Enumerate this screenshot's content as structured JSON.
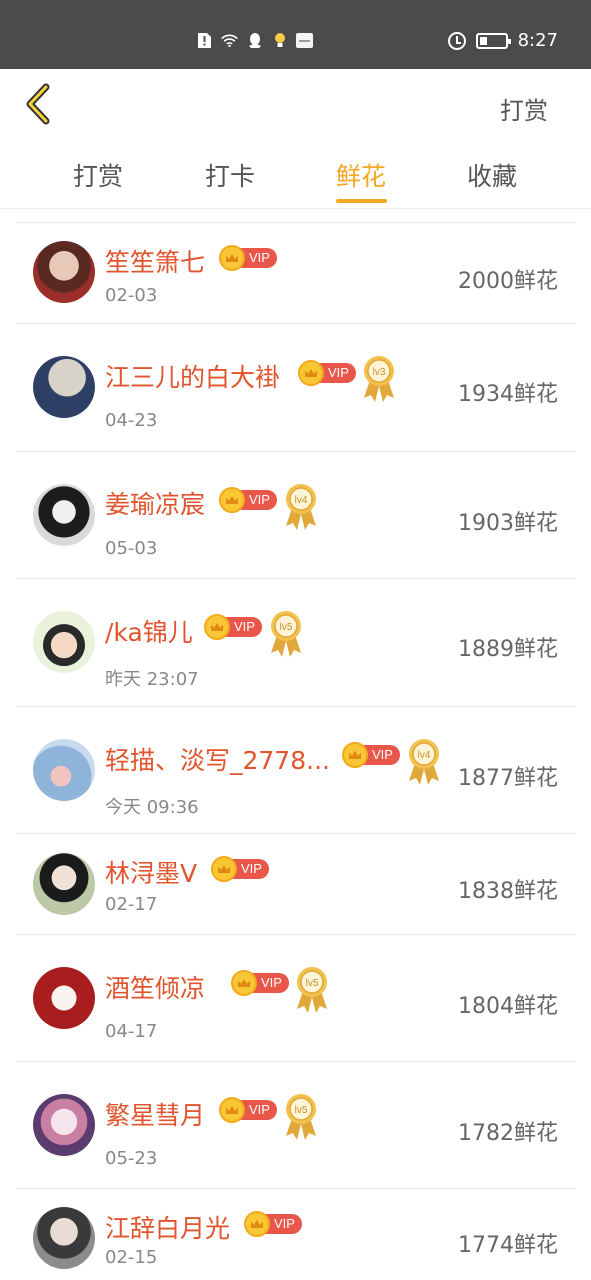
{
  "status_bar": {
    "icons": [
      "sim-alert-icon",
      "wifi-icon",
      "qq-icon",
      "bulb-icon",
      "app-notification-icon"
    ],
    "time": "8:27"
  },
  "header": {
    "back_icon": "chevron-left-icon",
    "action_label": "打赏"
  },
  "tabs": [
    {
      "label": "打赏",
      "active": false
    },
    {
      "label": "打卡",
      "active": false
    },
    {
      "label": "鲜花",
      "active": true
    },
    {
      "label": "收藏",
      "active": false
    }
  ],
  "vip_label": "VIP",
  "rows": [
    {
      "name": "笙笙箫七",
      "date": "02-03",
      "amount": "2000鲜花",
      "level": ""
    },
    {
      "name": "江三儿的白大褂",
      "date": "04-23",
      "amount": "1934鲜花",
      "level": "lv3"
    },
    {
      "name": "姜瑜凉宸",
      "date": "05-03",
      "amount": "1903鲜花",
      "level": "lv4"
    },
    {
      "name": "/ka锦儿",
      "date": "昨天 23:07",
      "amount": "1889鲜花",
      "level": "lv5"
    },
    {
      "name": "轻描、淡写_2778...",
      "date": "今天 09:36",
      "amount": "1877鲜花",
      "level": "lv4"
    },
    {
      "name": "林浔墨V",
      "date": "02-17",
      "amount": "1838鲜花",
      "level": ""
    },
    {
      "name": "酒笙倾凉",
      "date": "04-17",
      "amount": "1804鲜花",
      "level": "lv5"
    },
    {
      "name": "繁星彗月",
      "date": "05-23",
      "amount": "1782鲜花",
      "level": "lv5"
    },
    {
      "name": "江辞白月光",
      "date": "02-15",
      "amount": "1774鲜花",
      "level": ""
    }
  ],
  "colors": {
    "accent": "#f5a623",
    "name": "#e0542e",
    "vip_tag": "#e8574a",
    "status_bar": "#4b4b4b"
  }
}
